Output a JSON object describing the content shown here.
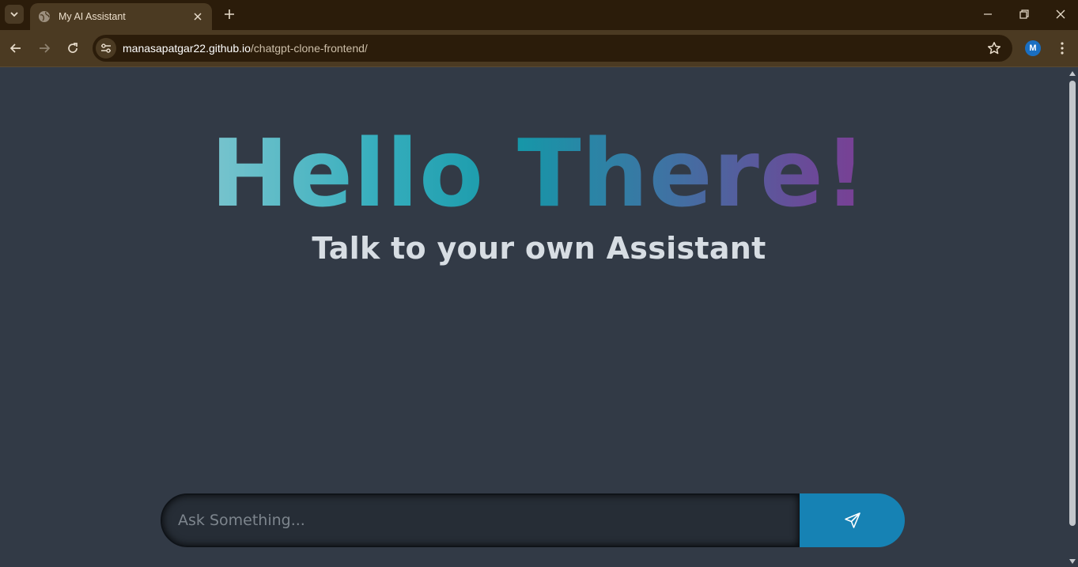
{
  "browser": {
    "tab": {
      "title": "My AI Assistant"
    },
    "url": {
      "host": "manasapatgar22.github.io",
      "path": "/chatgpt-clone-frontend/"
    },
    "profile_initial": "M"
  },
  "page": {
    "hero_words": [
      "Hello",
      "There!"
    ],
    "subtitle": "Talk to your own Assistant",
    "composer": {
      "placeholder": "Ask Something...",
      "value": ""
    }
  },
  "colors": {
    "chrome_dark": "#2b1c0a",
    "chrome": "#4b3a22",
    "page_bg": "#323a46",
    "send_button": "#1682b4",
    "gradient_start": "#d8dde0",
    "gradient_mid": "#1697a8",
    "gradient_end": "#b0208a"
  }
}
